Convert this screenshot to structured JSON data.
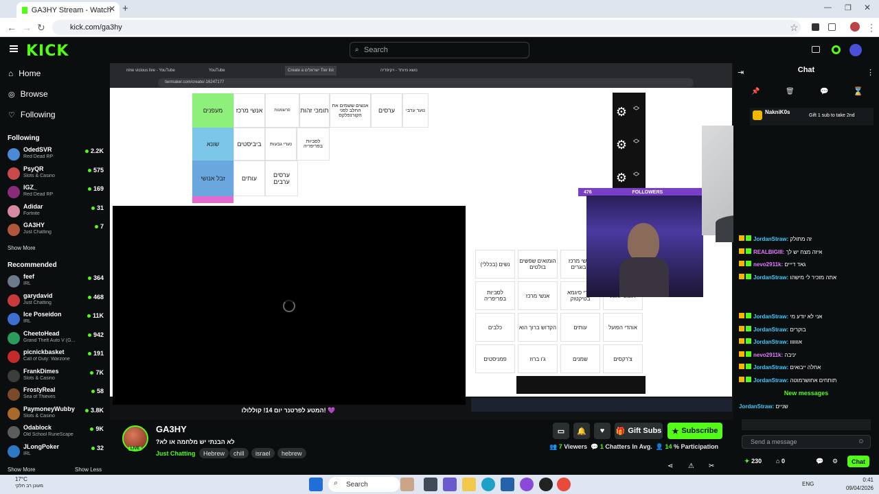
{
  "browser": {
    "tab_title": "GA3HY Stream - Watch Live on",
    "url": "kick.com/ga3hy"
  },
  "header": {
    "logo": "KICK",
    "search_placeholder": "Search"
  },
  "sidebar": {
    "nav": [
      {
        "label": "Home",
        "icon": "home-icon"
      },
      {
        "label": "Browse",
        "icon": "compass-icon"
      },
      {
        "label": "Following",
        "icon": "heart-icon"
      }
    ],
    "following_title": "Following",
    "following": [
      {
        "name": "OdedSVR",
        "category": "Red Dead RP",
        "viewers": "2.2K",
        "color": "#4b8bd6"
      },
      {
        "name": "PsyQR",
        "category": "Slots & Casino",
        "viewers": "575",
        "color": "#c94a4a"
      },
      {
        "name": "IGZ_",
        "category": "Red Dead RP",
        "viewers": "169",
        "color": "#8a2a7a"
      },
      {
        "name": "Adidar",
        "category": "Fortnite",
        "viewers": "31",
        "color": "#d78aa3"
      },
      {
        "name": "GA3HY",
        "category": "Just Chatting",
        "viewers": "7",
        "color": "#b0563a"
      }
    ],
    "show_more": "Show More",
    "recommended_title": "Recommended",
    "recommended": [
      {
        "name": "feef",
        "category": "IRL",
        "viewers": "364",
        "color": "#6c7a8a"
      },
      {
        "name": "garydavid",
        "category": "Just Chatting",
        "viewers": "468",
        "color": "#c83a3a"
      },
      {
        "name": "Ice Poseidon",
        "category": "IRL",
        "viewers": "11K",
        "color": "#3d6fd1"
      },
      {
        "name": "CheetoHead",
        "category": "Grand Theft Auto V (G...",
        "viewers": "942",
        "color": "#2c9c5c"
      },
      {
        "name": "picnickbasket",
        "category": "Call of Duty: Warzone",
        "viewers": "191",
        "color": "#c42a2a"
      },
      {
        "name": "FrankDimes",
        "category": "Slots & Casino",
        "viewers": "7K",
        "color": "#3c3c3c"
      },
      {
        "name": "FrostyReal",
        "category": "Sea of Thieves",
        "viewers": "58",
        "color": "#7a4a2a"
      },
      {
        "name": "PaymoneyWubby",
        "category": "Slots & Casino",
        "viewers": "3.8K",
        "color": "#a86a2a"
      },
      {
        "name": "Odablock",
        "category": "Old School RuneScape",
        "viewers": "9K",
        "color": "#5c5c5c"
      },
      {
        "name": "JLongPoker",
        "category": "IRL",
        "viewers": "32",
        "color": "#2c7ac4"
      }
    ],
    "show_more_2": "Show More",
    "show_less": "Show Less"
  },
  "stream_content": {
    "inner_tabs": [
      "nine vicious live - YouTube",
      "YouTube",
      "Create a ישראלים Tier list",
      "נושא מיוחד - ויקיפדיה"
    ],
    "inner_url": "tiermaker.com/create/-16247177",
    "rows": [
      {
        "label": "מעפנים",
        "color": "#8ef07a",
        "items": [
          "אנשי מרכז",
          "פרשמנות",
          "תומכי זהות",
          "אנשים ששמים את החלב לפני הקורנפלקס",
          "ערסים",
          "נוער ערבי"
        ]
      },
      {
        "label": "שונא",
        "color": "#7cc6ea",
        "items": [
          "ביביסטים",
          "נערי גבעות",
          "לסביות בפריפריה"
        ]
      },
      {
        "label": "זבל אנושי",
        "color": "#6aa7df",
        "items": [
          "עותים",
          "ערסים ערבים"
        ]
      }
    ],
    "pool_items": [
      "נשים (בכללי)",
      "הומואים שפשים בולטים",
      "אנשי מרכז הבוגרים",
      "לסביות",
      "לסביות בפריפריה",
      "אנשי מרכז",
      "גברי סיגמא בטיקטוק",
      "תומכי זהות",
      "כלבים",
      "הקדוש ברוך הוא",
      "עותים",
      "אוהדי הפועל",
      "פמניסטים",
      "ג'ו ברוז",
      "שמנים",
      "צ'רקסים"
    ],
    "caption": "המטע לפרטנר יום 14! קוללולו! 💜",
    "followers_label": "FOLLOWERS",
    "followers_count": "476"
  },
  "stream_info": {
    "streamer": "GA3HY",
    "live": "LIVE",
    "title": "?לא הבנתי יש מלחמה או לא",
    "category": "Just Chatting",
    "tags": [
      "Hebrew",
      "chill",
      "israel",
      "hebrew"
    ],
    "gift_subs": "Gift Subs",
    "subscribe": "Subscribe",
    "viewers": "7",
    "viewers_label": "Viewers",
    "chatters": "1",
    "chatters_label": "Chatters In Avg.",
    "participation": "14",
    "participation_label": "% Participation"
  },
  "chat": {
    "title": "Chat",
    "pinned_user": "NakniK0s",
    "pinned_text": "Gift 1 sub to take 2nd",
    "messages": [
      {
        "user": "JordanStraw:",
        "text": "זה מתולק",
        "cls": "u"
      },
      {
        "user": "REALBIGIII:",
        "text": "איזה מצח יש לך",
        "cls": "u3"
      },
      {
        "user": "nevo2911k:",
        "text": "גאד דייים",
        "cls": "u3"
      },
      {
        "user": "JordanStraw:",
        "text": "אתה מזכיר לי מישהו",
        "cls": "u"
      },
      {
        "user": "JordanStraw:",
        "text": "אני לא יודע מי",
        "cls": "u"
      },
      {
        "user": "JordanStraw:",
        "text": "בוקרים",
        "cls": "u"
      },
      {
        "user": "JordanStraw:",
        "text": "אוווווו",
        "cls": "u"
      },
      {
        "user": "nevo2911k:",
        "text": "יניבה",
        "cls": "u3"
      },
      {
        "user": "JordanStraw:",
        "text": "אחלה ייבואים",
        "cls": "u"
      },
      {
        "user": "JordanStraw:",
        "text": "תותחים אחושרמוטה",
        "cls": "u"
      }
    ],
    "new_messages": "New messages",
    "last_message": {
      "user": "JordanStraw:",
      "text": "שניים"
    },
    "send_placeholder": "Send a message",
    "points": "230",
    "zero": "0",
    "chat_button": "Chat"
  },
  "taskbar": {
    "weather": "17°C",
    "weather_text": "מעונן רב חלקי",
    "search": "Search",
    "lang": "ENG",
    "time": "0:41",
    "date": "09/04/2026"
  }
}
